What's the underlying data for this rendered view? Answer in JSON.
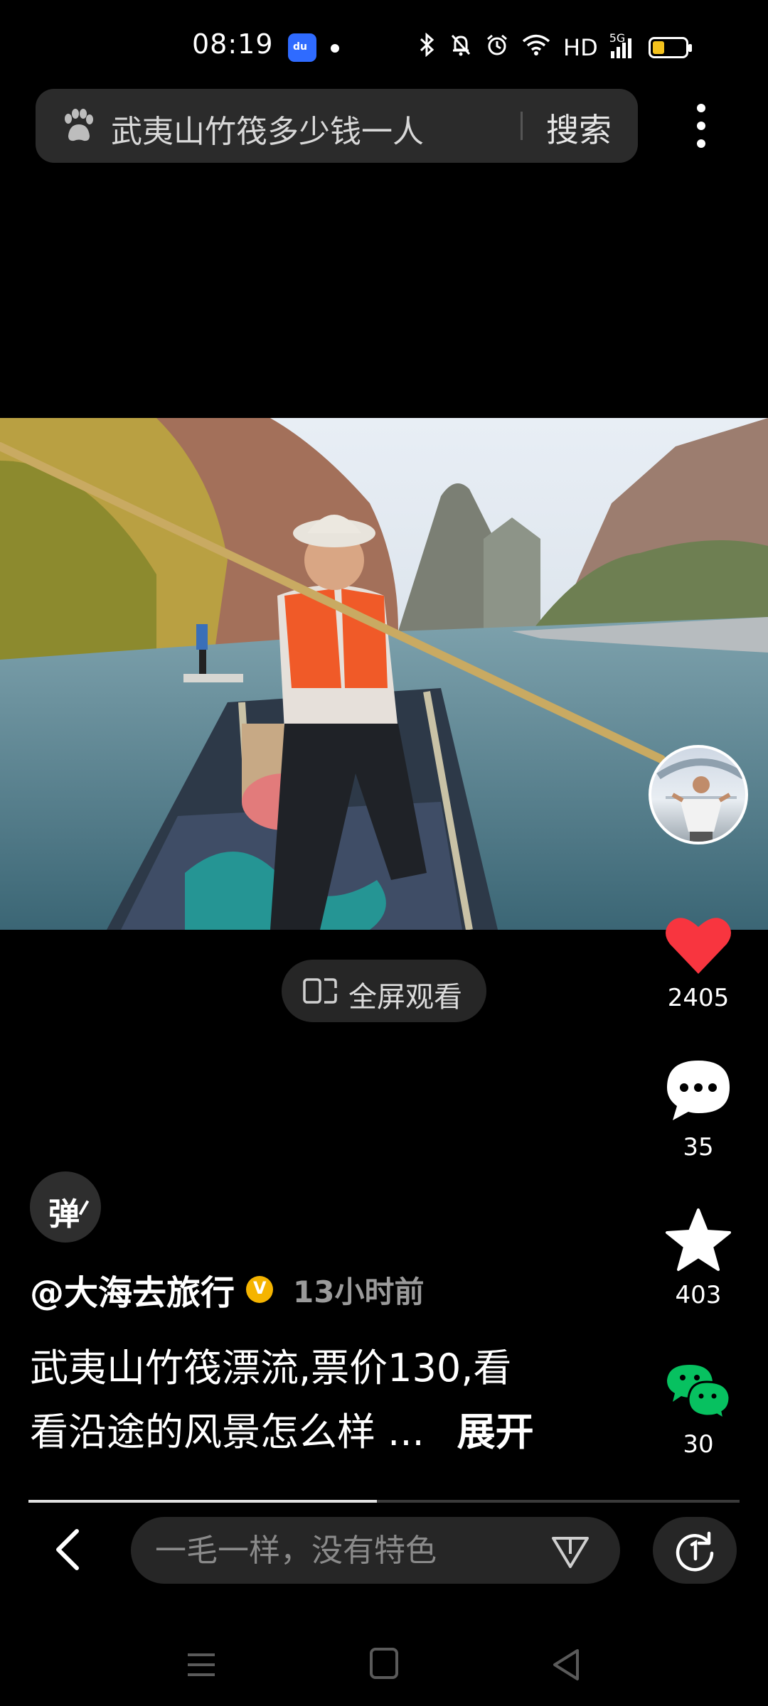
{
  "status_bar": {
    "time": "08:19",
    "icons": [
      "baidu-app-icon",
      "bluetooth-icon",
      "mute-bell-icon",
      "alarm-icon",
      "wifi-icon",
      "hd-label",
      "5g-signal-icon",
      "battery-icon"
    ],
    "hd_label": "HD",
    "network": "5G",
    "battery_color": "#f4c21d"
  },
  "search": {
    "query": "武夷山竹筏多少钱一人",
    "button_label": "搜索"
  },
  "video": {
    "description": "river bamboo raft scene"
  },
  "fullscreen": {
    "label": "全屏观看"
  },
  "actions": {
    "like_count": "2405",
    "comment_count": "35",
    "favorite_count": "403",
    "share_count": "30",
    "like_color": "#f8353f",
    "wechat_color": "#07c160"
  },
  "danmaku": {
    "label": "弹"
  },
  "post": {
    "author": "@大海去旅行",
    "time_ago": "13小时前",
    "description_line1": "武夷山竹筏漂流,票价130,看",
    "description_line2": "看沿途的风景怎么样 ...",
    "expand_label": "展开"
  },
  "playback": {
    "progress": 0.49
  },
  "comment_bar": {
    "placeholder": "一毛一样，没有特色"
  }
}
